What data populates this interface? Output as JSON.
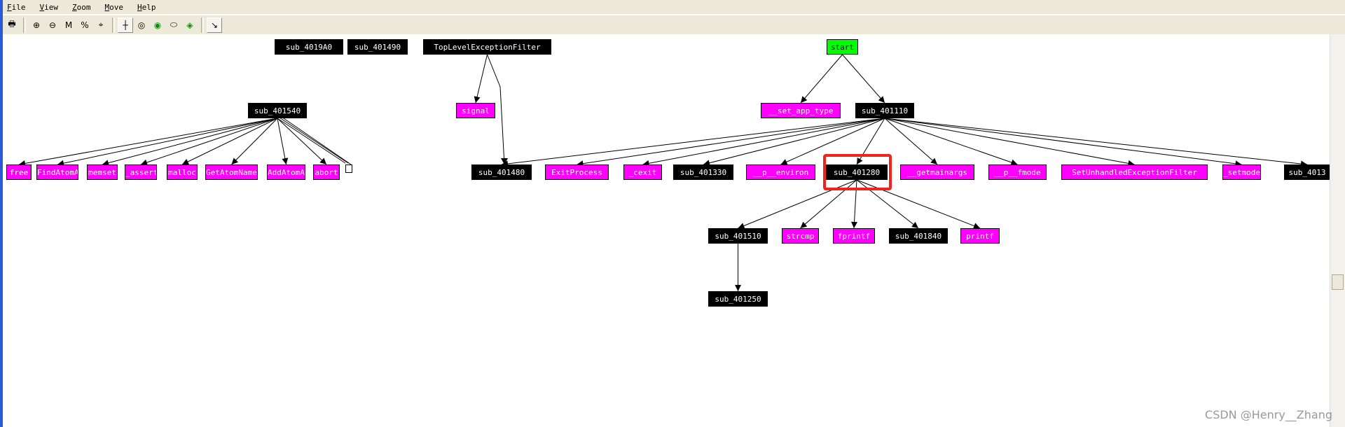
{
  "menu": [
    "File",
    "View",
    "Zoom",
    "Move",
    "Help"
  ],
  "toolbar": [
    {
      "icon": "print-icon",
      "glyph": "🖶"
    },
    {
      "icon": "zoom-in-icon",
      "glyph": "⊕"
    },
    {
      "icon": "zoom-out-icon",
      "glyph": "⊖"
    },
    {
      "icon": "fit-window-icon",
      "glyph": "M"
    },
    {
      "icon": "zoom-100-icon",
      "glyph": "%"
    },
    {
      "icon": "center-icon",
      "glyph": "⌖"
    },
    {
      "icon": "orientation-north-icon",
      "glyph": "┼"
    },
    {
      "icon": "overview-icon",
      "glyph": "◎"
    },
    {
      "icon": "fish-green-icon",
      "glyph": "◉"
    },
    {
      "icon": "fish-outline-icon",
      "glyph": "⬭"
    },
    {
      "icon": "fish-move-icon",
      "glyph": "◈"
    },
    {
      "icon": "arrow-cursor-icon",
      "glyph": "↘"
    }
  ],
  "colors": {
    "import": "#ff00ff",
    "function": "#000000",
    "entry": "#00ff00",
    "highlight": "#f2231b"
  },
  "nodes": [
    {
      "label": "sub_4019A0",
      "kind": "func"
    },
    {
      "label": "sub_401490",
      "kind": "func"
    },
    {
      "label": "TopLevelExceptionFilter",
      "kind": "func"
    },
    {
      "label": "start",
      "kind": "entry"
    },
    {
      "label": "sub_401540",
      "kind": "func"
    },
    {
      "label": "signal",
      "kind": "import"
    },
    {
      "label": "__set_app_type",
      "kind": "import"
    },
    {
      "label": "sub_401110",
      "kind": "func"
    },
    {
      "label": "free",
      "kind": "import"
    },
    {
      "label": "FindAtomA",
      "kind": "import"
    },
    {
      "label": "memset",
      "kind": "import"
    },
    {
      "label": "_assert",
      "kind": "import"
    },
    {
      "label": "malloc",
      "kind": "import"
    },
    {
      "label": "GetAtomNameA",
      "kind": "import"
    },
    {
      "label": "AddAtomA",
      "kind": "import"
    },
    {
      "label": "abort",
      "kind": "import"
    },
    {
      "label": "sub_401480",
      "kind": "func"
    },
    {
      "label": "ExitProcess",
      "kind": "import"
    },
    {
      "label": "_cexit",
      "kind": "import"
    },
    {
      "label": "sub_401330",
      "kind": "func"
    },
    {
      "label": "__p__environ",
      "kind": "import"
    },
    {
      "label": "sub_401280",
      "kind": "func"
    },
    {
      "label": "__getmainargs",
      "kind": "import"
    },
    {
      "label": "__p__fmode",
      "kind": "import"
    },
    {
      "label": "SetUnhandledExceptionFilter",
      "kind": "import"
    },
    {
      "label": "_setmode",
      "kind": "import"
    },
    {
      "label": "sub_4013",
      "kind": "func"
    },
    {
      "label": "sub_401510",
      "kind": "func"
    },
    {
      "label": "strcmp",
      "kind": "import"
    },
    {
      "label": "fprintf",
      "kind": "import"
    },
    {
      "label": "sub_401840",
      "kind": "func"
    },
    {
      "label": "printf",
      "kind": "import"
    },
    {
      "label": "sub_401250",
      "kind": "func"
    }
  ],
  "edges": [
    [
      "TopLevelExceptionFilter",
      "signal"
    ],
    [
      "TopLevelExceptionFilter",
      "sub_401480"
    ],
    [
      "start",
      "__set_app_type"
    ],
    [
      "start",
      "sub_401110"
    ],
    [
      "sub_401540",
      "free"
    ],
    [
      "sub_401540",
      "FindAtomA"
    ],
    [
      "sub_401540",
      "memset"
    ],
    [
      "sub_401540",
      "_assert"
    ],
    [
      "sub_401540",
      "malloc"
    ],
    [
      "sub_401540",
      "GetAtomNameA"
    ],
    [
      "sub_401540",
      "AddAtomA"
    ],
    [
      "sub_401540",
      "abort"
    ],
    [
      "sub_401110",
      "sub_401480"
    ],
    [
      "sub_401110",
      "ExitProcess"
    ],
    [
      "sub_401110",
      "_cexit"
    ],
    [
      "sub_401110",
      "sub_401330"
    ],
    [
      "sub_401110",
      "__p__environ"
    ],
    [
      "sub_401110",
      "sub_401280"
    ],
    [
      "sub_401110",
      "__getmainargs"
    ],
    [
      "sub_401110",
      "__p__fmode"
    ],
    [
      "sub_401110",
      "SetUnhandledExceptionFilter"
    ],
    [
      "sub_401110",
      "_setmode"
    ],
    [
      "sub_401110",
      "sub_4013"
    ],
    [
      "sub_401280",
      "sub_401510"
    ],
    [
      "sub_401280",
      "strcmp"
    ],
    [
      "sub_401280",
      "fprintf"
    ],
    [
      "sub_401280",
      "sub_401840"
    ],
    [
      "sub_401280",
      "printf"
    ],
    [
      "sub_401510",
      "sub_401250"
    ]
  ],
  "highlighted_node": "sub_401280",
  "watermark": "CSDN @Henry__Zhang"
}
